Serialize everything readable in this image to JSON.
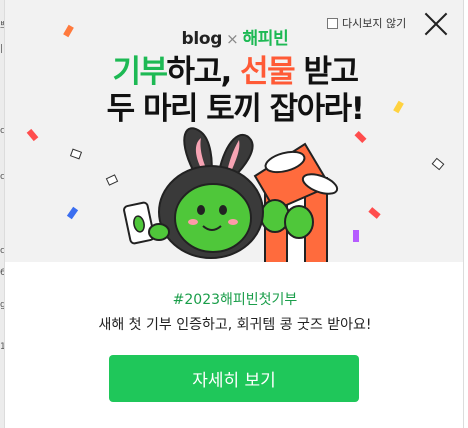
{
  "background_page": {
    "edge_glyphs": [
      "쁘",
      "|",
      "c",
      "c",
      "c",
      "6",
      "g",
      "1"
    ]
  },
  "header": {
    "brand_blog": "blog",
    "brand_times": "×",
    "brand_partner": "해피빈",
    "dont_show_label": "다시보지 않기"
  },
  "hero": {
    "headline_line1_part1": "기부",
    "headline_line1_part2": "하고, ",
    "headline_line1_part3": "선물",
    "headline_line1_part4": " 받고",
    "headline_line2": "두 마리 토끼 잡아라!"
  },
  "content": {
    "hashtag": "#2023해피빈첫기부",
    "description": "새해 첫 기부 인증하고, 회귀템 콩 굿즈 받아요!",
    "cta_label": "자세히 보기"
  },
  "colors": {
    "accent_green": "#1db954",
    "accent_red": "#ff5a36",
    "cta_green": "#1fc75a",
    "hashtag_green": "#1a9e4a"
  },
  "icons": {
    "close": "close-icon",
    "checkbox": "checkbox-icon"
  }
}
